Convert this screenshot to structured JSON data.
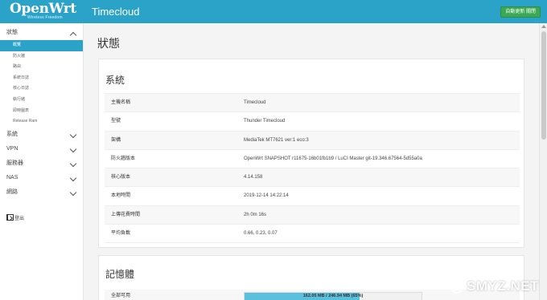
{
  "brand": {
    "name": "OpenWrt",
    "tagline": "Wireless Freedom"
  },
  "header": {
    "hostname": "Timecloud",
    "badge": "自動更新 關閉"
  },
  "sidebar": {
    "status_label": "狀態",
    "status_sub": [
      "概覽",
      "防火牆",
      "路由",
      "系統日誌",
      "核心日誌",
      "執行緒",
      "即時圖表",
      "Release Ram"
    ],
    "groups": [
      "系統",
      "VPN",
      "服務器",
      "NAS",
      "網路"
    ],
    "logout": "登出"
  },
  "main": {
    "page_title": "狀態",
    "system": {
      "title": "系統",
      "rows": [
        {
          "k": "主機名稱",
          "v": "Timecloud"
        },
        {
          "k": "型號",
          "v": "Thunder Timecloud"
        },
        {
          "k": "架構",
          "v": "MediaTek MT7621 ver:1 eco:3"
        },
        {
          "k": "防火牆版本",
          "v": "OpenWrt SNAPSHOT r11675-16b01fb1b9 / LuCI Master git-19.346.67564-5d55a0a"
        },
        {
          "k": "核心版本",
          "v": "4.14.158"
        },
        {
          "k": "本地時間",
          "v": "2019-12-14 14:22:14"
        },
        {
          "k": "上傳花費時間",
          "v": "2h 0m 16s"
        },
        {
          "k": "平均負載",
          "v": "0.66, 0.23, 0.07"
        }
      ]
    },
    "memory": {
      "title": "記憶體",
      "row_label": "全部可用",
      "bar_text": "162.05 MB / 246.94 MB (65%)",
      "fraction": 0.65
    }
  },
  "watermark": "SMYZ.NET",
  "colors": {
    "accent": "#2ba3c9",
    "badge": "#3aa855",
    "progress": "#5ac0de"
  }
}
